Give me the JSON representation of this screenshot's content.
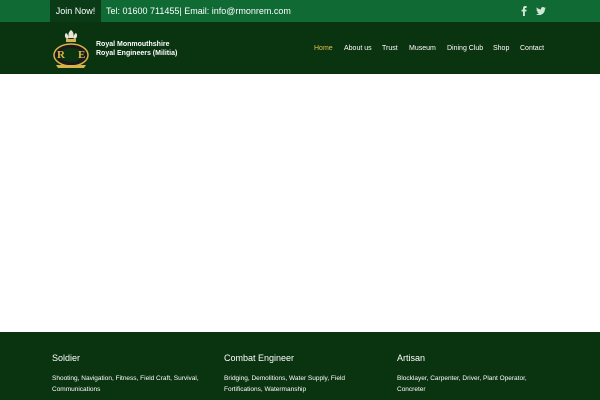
{
  "topbar": {
    "join_label": "Join Now!",
    "contact_text": "Tel: 01600 711455| Email: info@rmonrem.com",
    "social": [
      "facebook-icon",
      "twitter-icon"
    ],
    "bg_color": "#0f6a34",
    "join_bg_color": "#0a3a16"
  },
  "header": {
    "brand_line1": "Royal Monmouthshire",
    "brand_line2": "Royal Engineers (Militia)",
    "logo_letters": "R E",
    "bg_color": "#0a3310"
  },
  "nav": {
    "items": [
      {
        "label": "Home",
        "active": true
      },
      {
        "label": "About us",
        "active": false
      },
      {
        "label": "Trust",
        "active": false
      },
      {
        "label": "Museum",
        "active": false
      },
      {
        "label": "Dining Club",
        "active": false
      },
      {
        "label": "Shop",
        "active": false
      },
      {
        "label": "Contact",
        "active": false
      }
    ],
    "active_color": "#e1c14c"
  },
  "footer": {
    "columns": [
      {
        "heading": "Soldier",
        "text": "Shooting, Navigation, Fitness, Field Craft, Survival, Communications"
      },
      {
        "heading": "Combat Engineer",
        "text": "Bridging, Demolitions, Water Supply, Field Fortifications, Watermanship"
      },
      {
        "heading": "Artisan",
        "text": "Blocklayer, Carpenter, Driver, Plant Operator, Concreter"
      }
    ]
  }
}
